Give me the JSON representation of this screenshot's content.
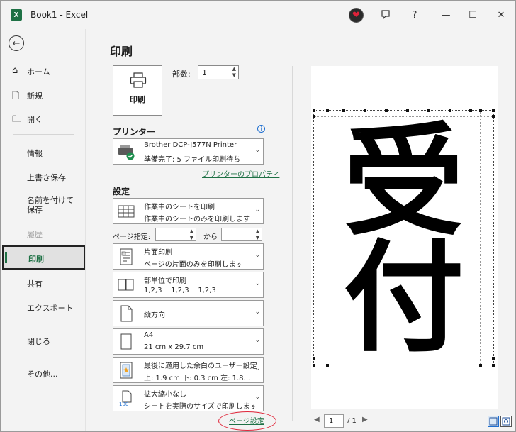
{
  "window": {
    "title": "Book1  -  Excel",
    "app_icon": "X",
    "controls": {
      "help": "?",
      "minimize": "—",
      "maximize": "☐",
      "close": "✕"
    }
  },
  "nav": {
    "home": "ホーム",
    "new": "新規",
    "open": "開く",
    "info": "情報",
    "save": "上書き保存",
    "save_as": "名前を付けて保存",
    "history": "履歴",
    "print": "印刷",
    "share": "共有",
    "export": "エクスポート",
    "close": "閉じる",
    "more": "その他..."
  },
  "print": {
    "title": "印刷",
    "print_button": "印刷",
    "copies_label": "部数:",
    "copies_value": "1",
    "printer_heading": "プリンター",
    "printer_name": "Brother DCP-J577N Printer",
    "printer_status": "準備完了; 5 ファイル印刷待ち",
    "printer_properties": "プリンターのプロパティ",
    "settings_heading": "設定",
    "what": {
      "line1": "作業中のシートを印刷",
      "line2": "作業中のシートのみを印刷します"
    },
    "pages_label": "ページ指定:",
    "pages_from": "",
    "pages_to_label": "から",
    "pages_to": "",
    "sides": {
      "line1": "片面印刷",
      "line2": "ページの片面のみを印刷します"
    },
    "collate": {
      "line1": "部単位で印刷",
      "line2": "1,2,3    1,2,3    1,2,3"
    },
    "orientation": {
      "line1": "縦方向"
    },
    "paper": {
      "line1": "A4",
      "line2": "21 cm x 29.7 cm"
    },
    "margins": {
      "line1": "最後に適用した余白のユーザー設定",
      "line2": "上: 1.9 cm 下: 0.3 cm 左: 1.8…"
    },
    "scaling": {
      "line1": "拡大縮小なし",
      "line2": "シートを実際のサイズで印刷します"
    },
    "scaling_icon_text": "100",
    "page_setup": "ページ設定"
  },
  "preview": {
    "text_top": "受",
    "text_bottom": "付",
    "current_page": "1",
    "total_pages": "/ 1"
  },
  "colors": {
    "accent": "#1e7145",
    "highlight_circle": "#e0263a"
  }
}
